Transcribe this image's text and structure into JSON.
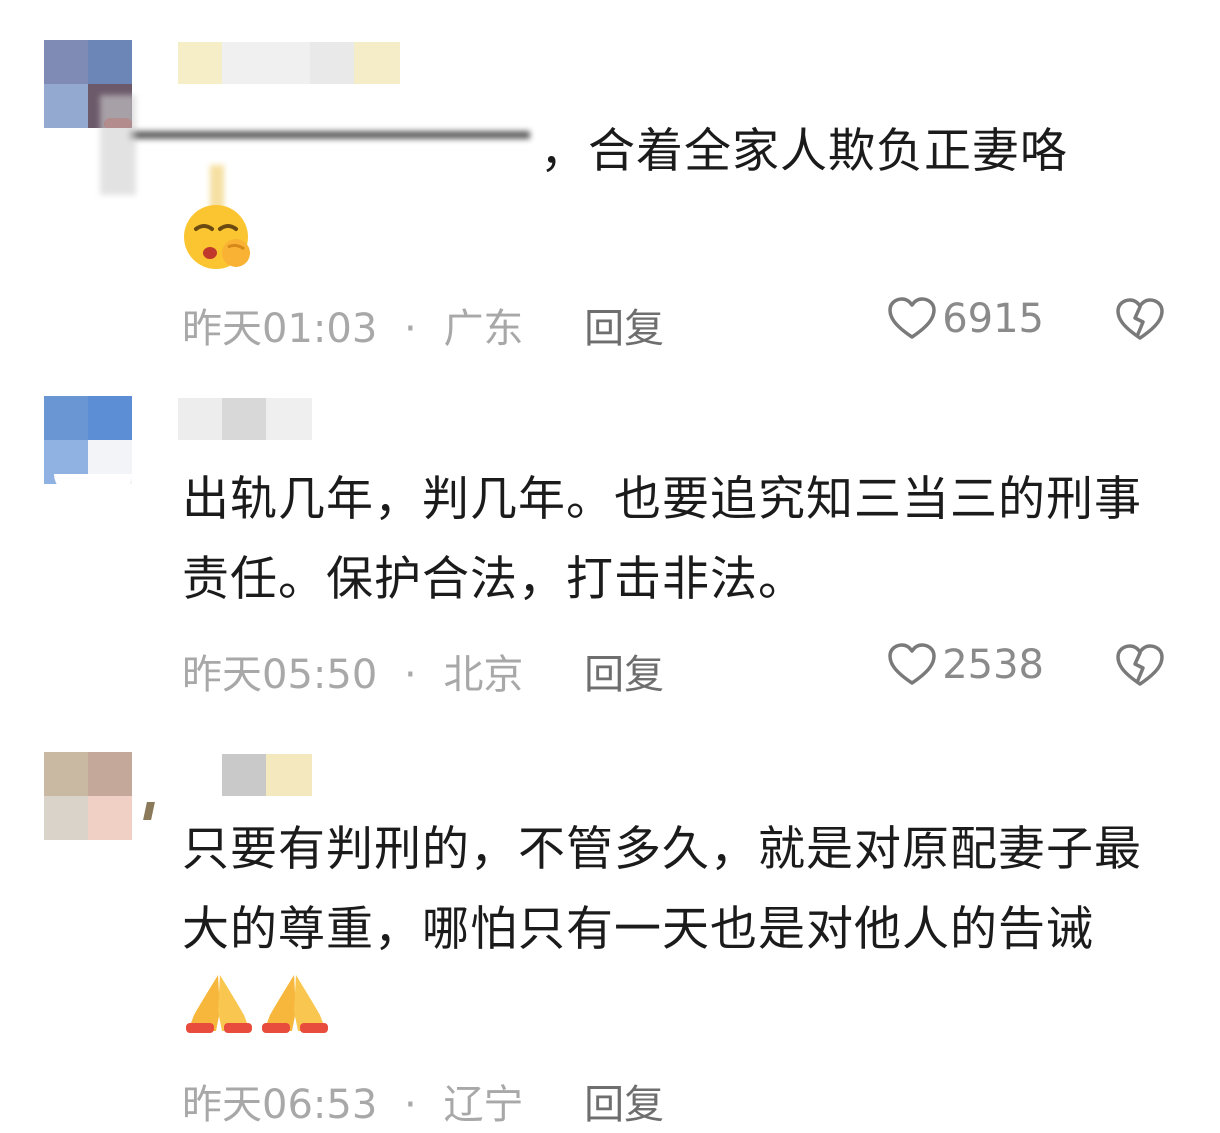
{
  "comments": [
    {
      "text": "，合着全家人欺负正妻咯",
      "emoji": "face-with-hand-over-mouth",
      "time": "昨天01:03",
      "sep": "·",
      "location": "广东",
      "reply": "回复",
      "likes": "6915"
    },
    {
      "text": "出轨几年，判几年。也要追究知三当三的刑事责任。保护合法，打击非法。",
      "time": "昨天05:50",
      "sep": "·",
      "location": "北京",
      "reply": "回复",
      "likes": "2538"
    },
    {
      "text": "只要有判刑的，不管多久，就是对原配妻子最大的尊重，哪怕只有一天也是对他人的告诫",
      "emoji": "folded-hands-x2",
      "time": "昨天06:53",
      "sep": "·",
      "location": "辽宁",
      "reply": "回复"
    }
  ],
  "colors": {
    "text": "#1b1b1b",
    "meta": "#a8a8a8",
    "reply": "#6e6e6e",
    "icon": "#7a7a7a"
  }
}
